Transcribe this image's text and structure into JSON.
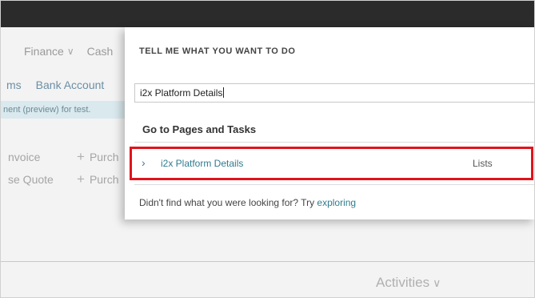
{
  "background": {
    "nav_primary": [
      {
        "label": "Finance",
        "has_dropdown": true
      },
      {
        "label": "Cash",
        "has_dropdown": false
      }
    ],
    "nav_secondary": [
      "ms",
      "Bank Account"
    ],
    "banner_text": "nent (preview) for test.",
    "actions_left": [
      "nvoice",
      "se Quote"
    ],
    "actions_right": [
      "Purch",
      "Purch"
    ],
    "activities_label": "Activities"
  },
  "dialog": {
    "title": "TELL ME WHAT YOU WANT TO DO",
    "search_value": "i2x Platform Details",
    "section_heading": "Go to Pages and Tasks",
    "results": [
      {
        "name": "i2x Platform Details",
        "category": "Lists",
        "highlighted": true
      }
    ],
    "footer_text": "Didn't find what you were looking for? Try ",
    "footer_link": "exploring"
  },
  "colors": {
    "topbar": "#2b2b2b",
    "highlight_border": "#e0141b",
    "link": "#2f7c8f",
    "banner": "#d9e9ee"
  }
}
